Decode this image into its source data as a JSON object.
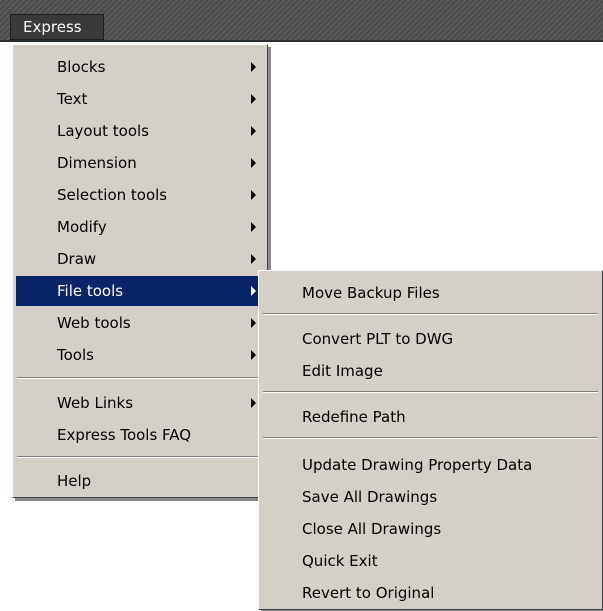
{
  "menubar": {
    "express": "Express"
  },
  "main_menu": {
    "blocks": "Blocks",
    "text": "Text",
    "layout_tools": "Layout tools",
    "dimension": "Dimension",
    "selection_tools": "Selection tools",
    "modify": "Modify",
    "draw": "Draw",
    "file_tools": "File tools",
    "web_tools": "Web tools",
    "tools": "Tools",
    "web_links": "Web Links",
    "express_tools_faq": "Express Tools FAQ",
    "help": "Help"
  },
  "file_tools_menu": {
    "move_backup_files": "Move Backup Files",
    "convert_plt_to_dwg": "Convert PLT to DWG",
    "edit_image": "Edit Image",
    "redefine_path": "Redefine Path",
    "update_drawing_property_data": "Update Drawing Property Data",
    "save_all_drawings": "Save All Drawings",
    "close_all_drawings": "Close All Drawings",
    "quick_exit": "Quick Exit",
    "revert_to_original": "Revert to Original"
  },
  "colors": {
    "menu_background": "#d4d0c8",
    "highlight": "#0a246a",
    "menubar": "#4b4b4b"
  },
  "icons": {
    "submenu": "right-triangle-arrow-icon"
  }
}
